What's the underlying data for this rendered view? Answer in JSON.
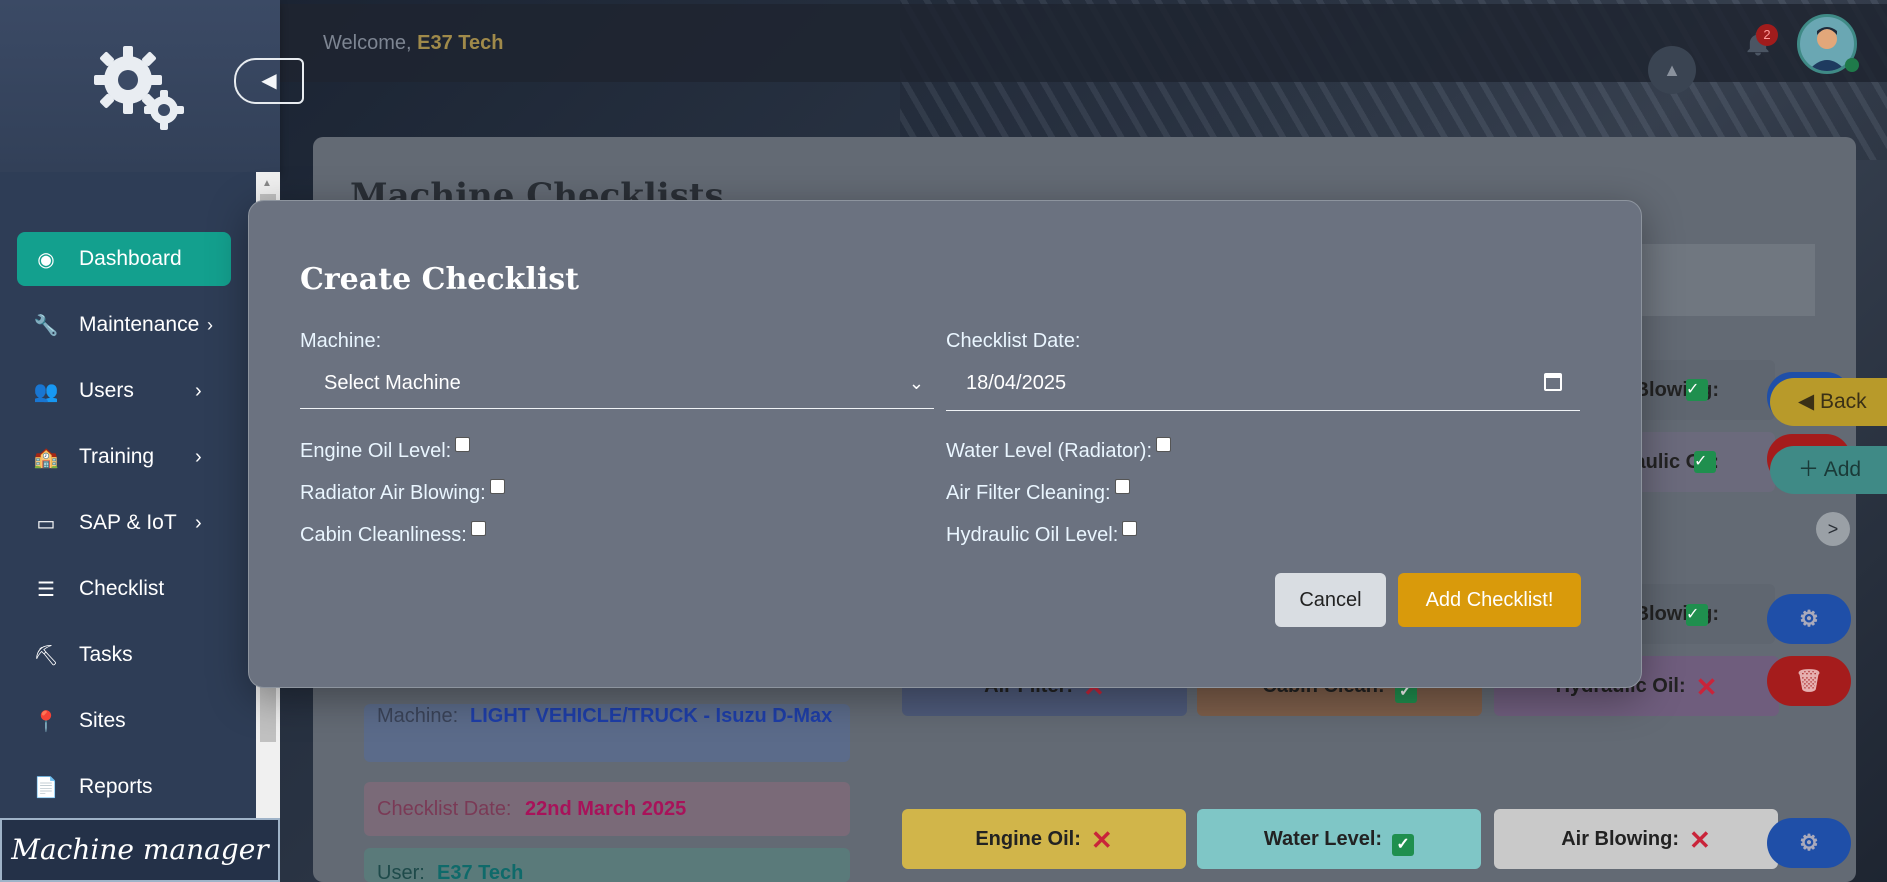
{
  "header": {
    "welcome_prefix": "Welcome, ",
    "user_name": "E37 Tech",
    "notification_count": "2"
  },
  "sidebar": {
    "items": [
      {
        "label": "Dashboard",
        "icon": "dashboard-icon",
        "active": true
      },
      {
        "label": "Maintenance",
        "icon": "wrench-icon"
      },
      {
        "label": "Users",
        "icon": "users-icon"
      },
      {
        "label": "Training",
        "icon": "training-icon"
      },
      {
        "label": "SAP & IoT",
        "icon": "sap-icon"
      },
      {
        "label": "Checklist",
        "icon": "checklist-icon"
      },
      {
        "label": "Tasks",
        "icon": "tasks-icon"
      },
      {
        "label": "Sites",
        "icon": "location-pin-icon"
      },
      {
        "label": "Reports",
        "icon": "report-icon"
      }
    ],
    "brand": "Machine manager"
  },
  "page": {
    "title": "Machine Checklists",
    "back_label": "Back",
    "add_label": "Add",
    "entries": [
      {
        "machine_label": "Machine:",
        "machine_value": "LIGHT VEHICLE/TRUCK - Isuzu D-Max",
        "tags": [
          {
            "label": "Air Filter:"
          },
          {
            "label": "Cabin Clean:"
          },
          {
            "label": "Hydraulic Oil:"
          }
        ]
      },
      {
        "date_label": "Checklist Date:",
        "date_value": "22nd March 2025",
        "user_label": "User:",
        "user_value": "E37 Tech",
        "tags": [
          {
            "label": "Engine Oil:"
          },
          {
            "label": "Water Level:"
          },
          {
            "label": "Air Blowing:"
          }
        ]
      }
    ],
    "partial_tags": [
      "Blowing:",
      "Hydraulic Oil:",
      "Blowing:"
    ]
  },
  "modal": {
    "title": "Create Checklist",
    "machine_label": "Machine:",
    "machine_selected": "Select Machine",
    "date_label": "Checklist Date:",
    "date_value": "18/04/2025",
    "checks_left": [
      "Engine Oil Level:",
      "Radiator Air Blowing:",
      "Cabin Cleanliness:"
    ],
    "checks_right": [
      "Water Level (Radiator):",
      "Air Filter Cleaning:",
      "Hydraulic Oil Level:"
    ],
    "cancel_label": "Cancel",
    "submit_label": "Add Checklist!"
  },
  "colors": {
    "accent_teal": "#13a08e",
    "submit_amber": "#d99a0b",
    "sidebar_bg": "#2e3d56"
  }
}
